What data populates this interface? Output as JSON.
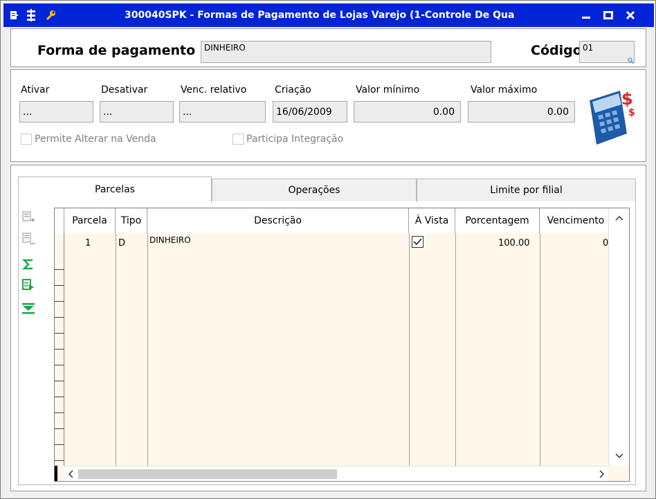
{
  "window": {
    "title": "300040SPK - Formas de Pagamento de Lojas Varejo (1-Controle De Qua",
    "colors": {
      "titlebar": "#0024d6",
      "icon_yellow": "#f5c400",
      "green": "#1aa84a",
      "grid_bg": "#fff8ea"
    }
  },
  "header": {
    "forma_label": "Forma de pagamento",
    "forma_value": "DINHEIRO",
    "codigo_label": "Código",
    "codigo_value": "01"
  },
  "details": {
    "ativar": {
      "label": "Ativar",
      "value": "..."
    },
    "desativar": {
      "label": "Desativar",
      "value": "..."
    },
    "venc_relativo": {
      "label": "Venc. relativo",
      "value": "..."
    },
    "criacao": {
      "label": "Criação",
      "value": "16/06/2009"
    },
    "valor_minimo": {
      "label": "Valor mínimo",
      "value": "0.00"
    },
    "valor_maximo": {
      "label": "Valor máximo",
      "value": "0.00"
    },
    "permite_alterar": "Permite Alterar na Venda",
    "participa_integracao": "Participa Integração"
  },
  "tabs": [
    {
      "label": "Parcelas",
      "active": true
    },
    {
      "label": "Operações",
      "active": false
    },
    {
      "label": "Limite por filial",
      "active": false
    }
  ],
  "grid": {
    "columns": [
      "Parcela",
      "Tipo",
      "Descrição",
      "À Vista",
      "Porcentagem",
      "Vencimento"
    ],
    "rows": [
      {
        "parcela": "1",
        "tipo": "D",
        "descricao": "DINHEIRO",
        "a_vista": true,
        "porcentagem": "100.00",
        "vencimento": "0"
      }
    ]
  }
}
